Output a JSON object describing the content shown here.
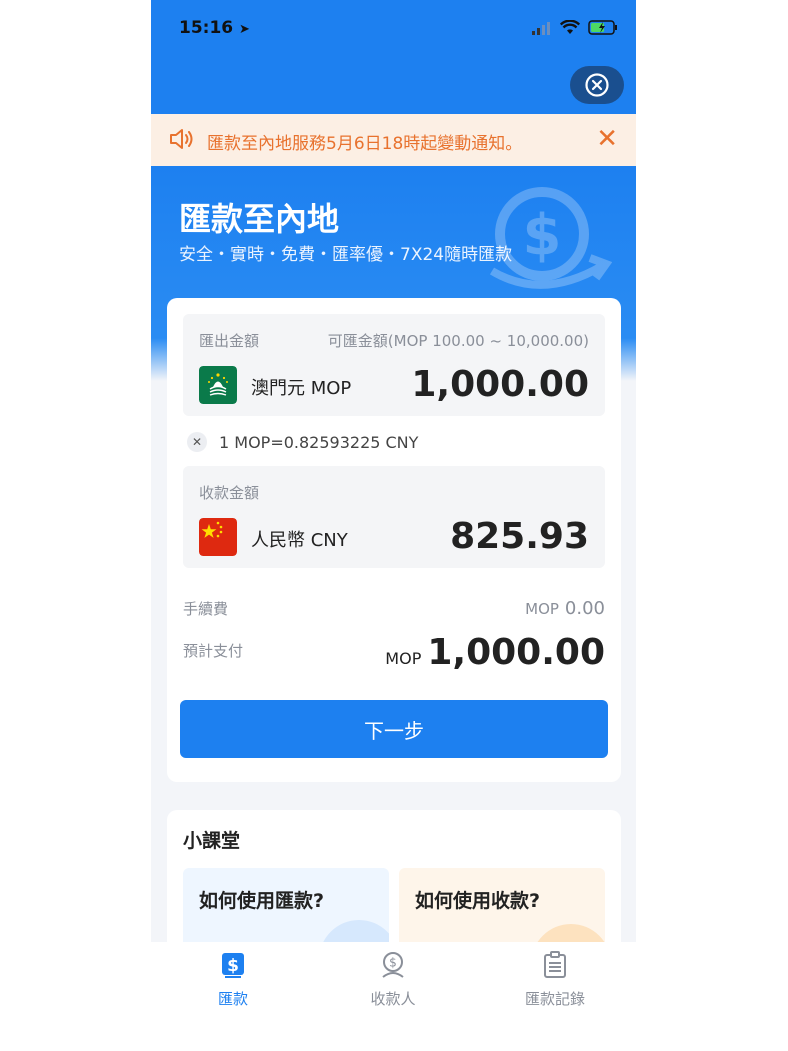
{
  "status_bar": {
    "time": "15:16"
  },
  "notice": {
    "text": "匯款至內地服務5月6日18時起變動通知。"
  },
  "hero": {
    "title": "匯款至內地",
    "subtitle": "安全・實時・免費・匯率優・7X24隨時匯款"
  },
  "send": {
    "label": "匯出金額",
    "available": "可匯金額(MOP 100.00 ~ 10,000.00)",
    "currency": "澳門元 MOP",
    "amount": "1,000.00"
  },
  "rate": {
    "text": "1 MOP=0.82593225 CNY"
  },
  "receive": {
    "label": "收款金額",
    "currency": "人民幣 CNY",
    "amount": "825.93"
  },
  "fee": {
    "label": "手續費",
    "currency": "MOP",
    "amount": "0.00"
  },
  "total": {
    "label": "預計支付",
    "currency": "MOP",
    "amount": "1,000.00"
  },
  "next_button": {
    "label": "下一步"
  },
  "lessons": {
    "title": "小課堂",
    "items": [
      {
        "label": "如何使用匯款?"
      },
      {
        "label": "如何使用收款?"
      }
    ]
  },
  "tabbar": {
    "items": [
      {
        "label": "匯款"
      },
      {
        "label": "收款人"
      },
      {
        "label": "匯款記錄"
      }
    ]
  },
  "colors": {
    "primary": "#1d80f0",
    "notice": "#e8722e",
    "notice_bg": "#fcefe4"
  }
}
